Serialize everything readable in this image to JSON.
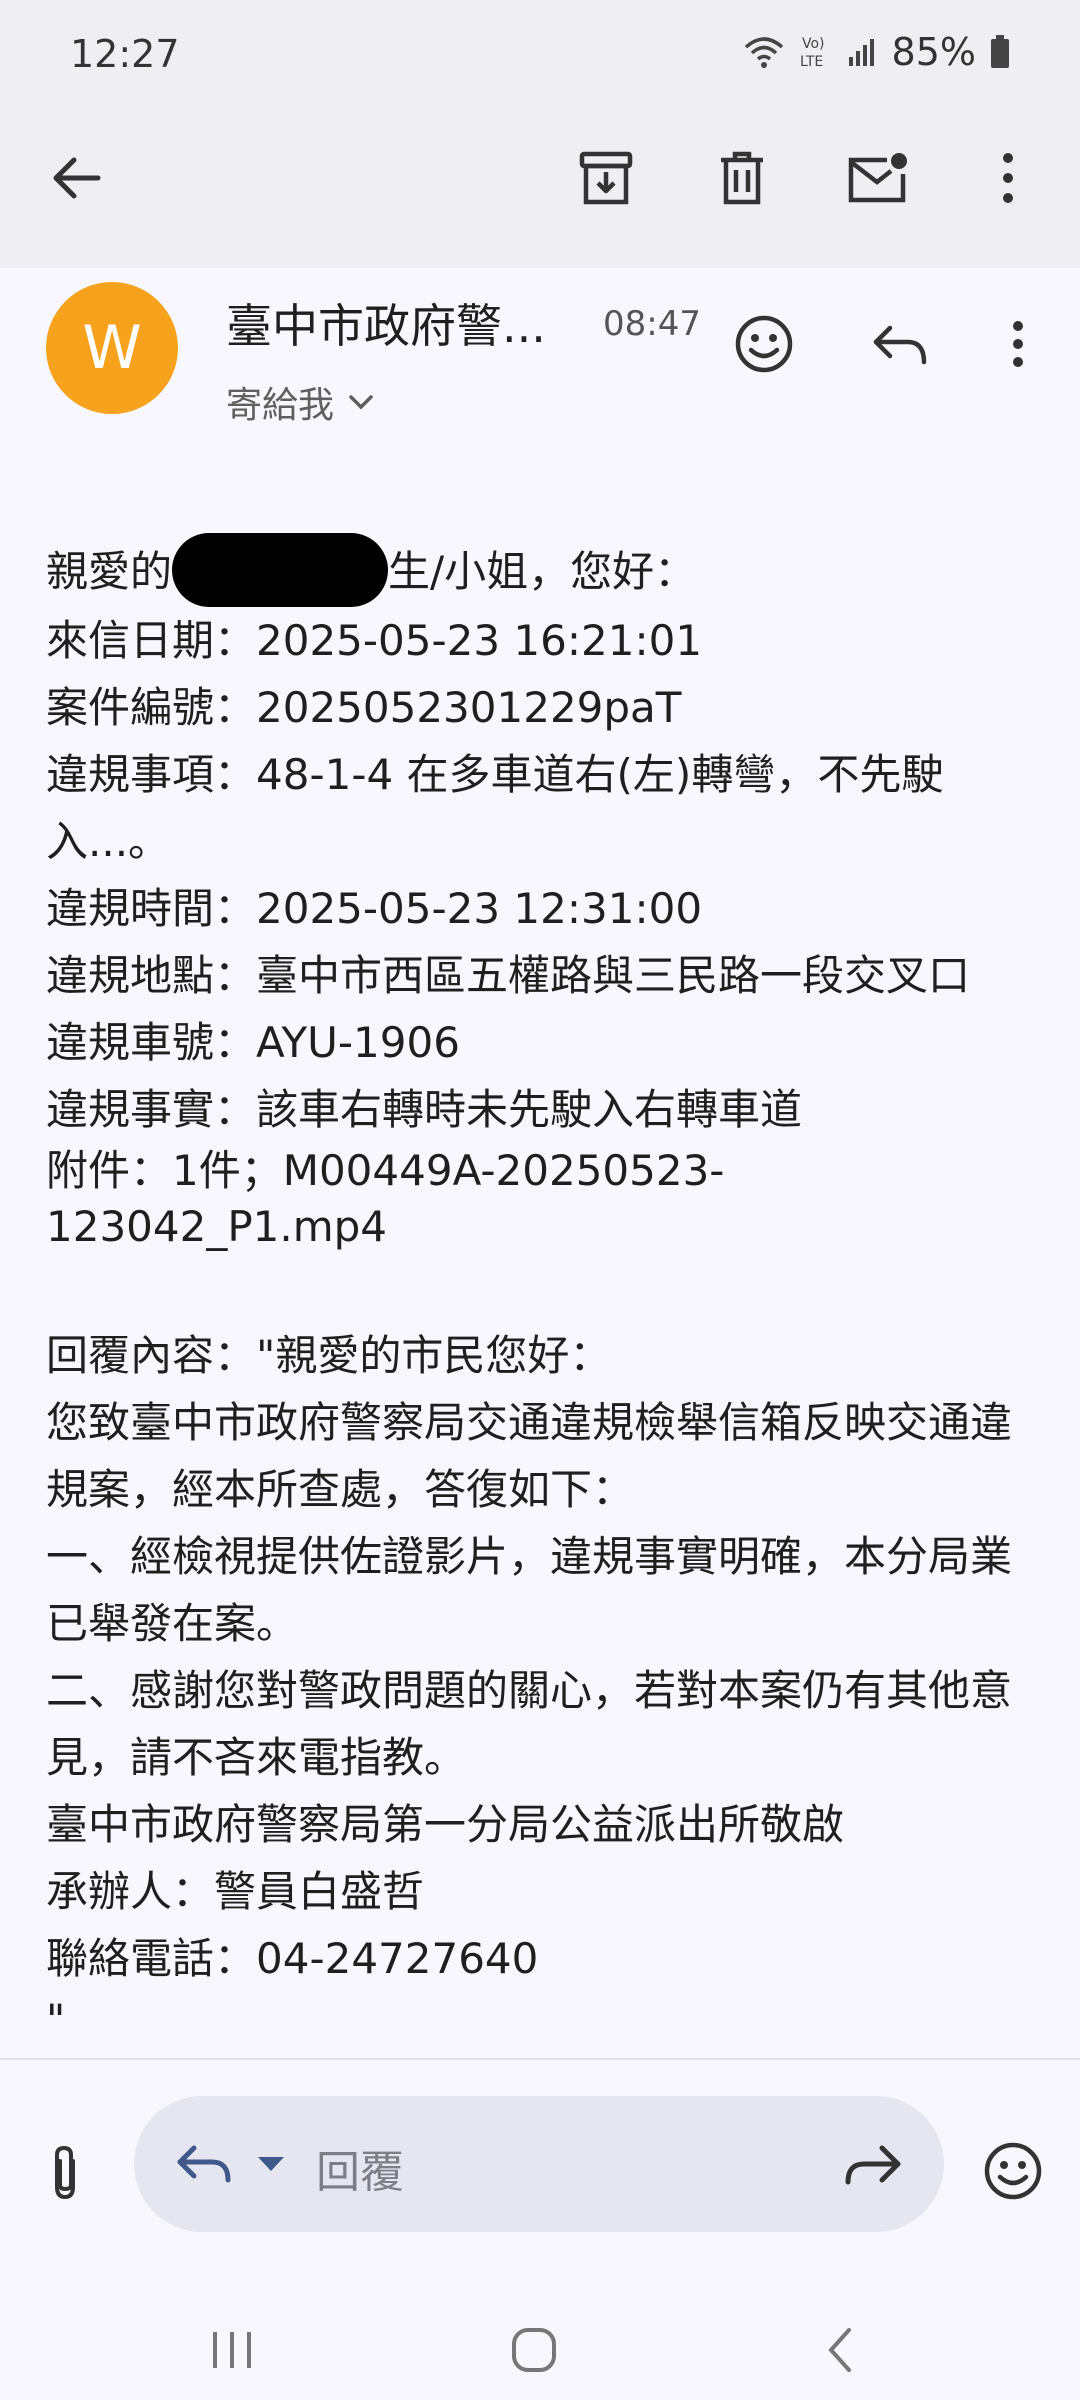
{
  "status_bar": {
    "time": "12:27",
    "network_label": "Vo) LTE",
    "battery": "85%"
  },
  "toolbar": {
    "icons": [
      "back-arrow-icon",
      "archive-icon",
      "delete-icon",
      "mark-unread-icon",
      "more-vert-icon"
    ]
  },
  "email": {
    "avatar_letter": "W",
    "avatar_color": "#f6a21d",
    "sender": "臺中市政府警...",
    "time": "08:47",
    "recipient": "寄給我"
  },
  "body": {
    "greeting_prefix": "親愛的",
    "greeting_suffix": "生/小姐，您好：",
    "lines": [
      "來信日期：2025-05-23 16:21:01",
      "案件編號：2025052301229paT",
      "違規事項：48-1-4 在多車道右(左)轉彎，不先駛入...。",
      "違規時間：2025-05-23 12:31:00",
      "違規地點：臺中市西區五權路與三民路一段交叉口",
      "違規車號：AYU-1906",
      "違規事實：該車右轉時未先駛入右轉車道"
    ],
    "attachment_line": "附件：1件；M00449A-20250523-123042_P1.mp4",
    "reply_lines": [
      "回覆內容：\"親愛的市民您好：",
      "您致臺中市政府警察局交通違規檢舉信箱反映交通違規案，經本所查處，答復如下：",
      "一、經檢視提供佐證影片，違規事實明確，本分局業已舉發在案。",
      "二、感謝您對警政問題的關心，若對本案仍有其他意見，請不吝來電指教。",
      "臺中市政府警察局第一分局公益派出所敬啟",
      "承辦人：警員白盛哲",
      "聯絡電話：04-24727640"
    ],
    "closing_quote": "\""
  },
  "compose": {
    "reply_placeholder": "回覆"
  }
}
